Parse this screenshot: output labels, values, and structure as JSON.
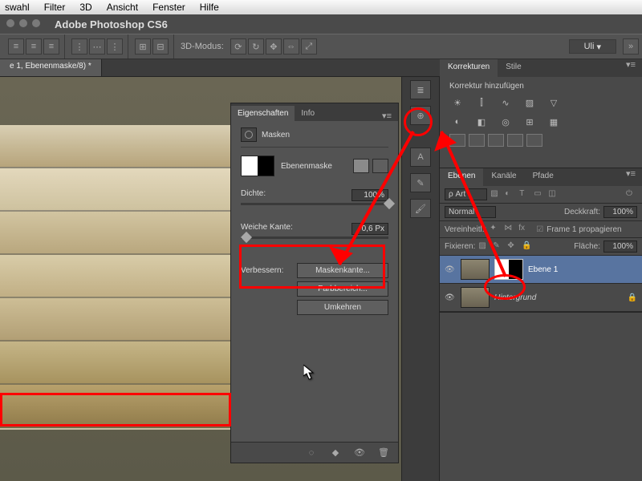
{
  "mac_menu": [
    "swahl",
    "Filter",
    "3D",
    "Ansicht",
    "Fenster",
    "Hilfe"
  ],
  "app_title": "Adobe Photoshop CS6",
  "options": {
    "mode3d": "3D-Modus:",
    "user": "Uli"
  },
  "document_tab": "e 1, Ebenenmaske/8) *",
  "properties": {
    "tabs": [
      "Eigenschaften",
      "Info"
    ],
    "section": "Masken",
    "mask_name": "Ebenenmaske",
    "density_label": "Dichte:",
    "density_value": "100%",
    "feather_label": "Weiche Kante:",
    "feather_value": "0,6 Px",
    "improve_label": "Verbessern:",
    "btn_maskedge": "Maskenkante...",
    "btn_colorrange": "Farbbereich...",
    "btn_invert": "Umkehren"
  },
  "adjustments": {
    "tabs": [
      "Korrekturen",
      "Stile"
    ],
    "add_label": "Korrektur hinzufügen"
  },
  "layers": {
    "tabs": [
      "Ebenen",
      "Kanäle",
      "Pfade"
    ],
    "filter_label": "ρ Art",
    "blend": "Normal",
    "opacity_label": "Deckkraft:",
    "opacity_value": "100%",
    "unify_label": "Vereinheitl.:",
    "propagate": "Frame 1 propagieren",
    "lock_label": "Fixieren:",
    "fill_label": "Fläche:",
    "fill_value": "100%",
    "items": [
      {
        "name": "Ebene 1"
      },
      {
        "name": "Hintergrund"
      }
    ]
  }
}
